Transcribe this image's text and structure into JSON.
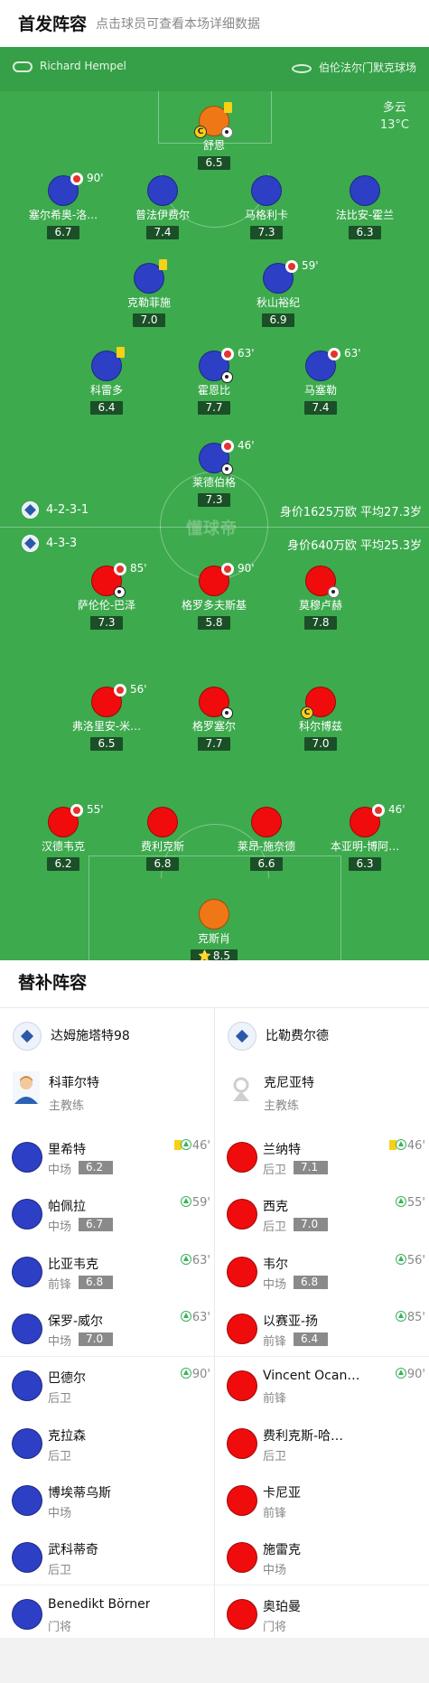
{
  "header": {
    "title": "首发阵容",
    "subtitle": "点击球员可查看本场详细数据"
  },
  "pitch": {
    "referee": "Richard Hempel",
    "stadium": "伯伦法尔门默克球场",
    "weather_desc": "多云",
    "weather_temp": "13°C",
    "watermark": "懂球帝",
    "home_formation": "4-2-3-1",
    "home_info": "身价1625万欧  平均27.3岁",
    "away_formation": "4-3-3",
    "away_info": "身价640万欧  平均25.3岁"
  },
  "home_players": [
    {
      "name": "舒恩",
      "rating": "6.5",
      "color": "orange",
      "captain": "C",
      "yellow": true,
      "ball": "grey"
    },
    {
      "name": "塞尔希奥-洛…",
      "rating": "6.7",
      "color": "blue",
      "sub_min": "90'"
    },
    {
      "name": "普法伊费尔",
      "rating": "7.4",
      "color": "blue"
    },
    {
      "name": "马格利卡",
      "rating": "7.3",
      "color": "blue"
    },
    {
      "name": "法比安-霍兰",
      "rating": "6.3",
      "color": "blue"
    },
    {
      "name": "克勒菲施",
      "rating": "7.0",
      "color": "blue",
      "yellow": true
    },
    {
      "name": "秋山裕纪",
      "rating": "6.9",
      "color": "blue",
      "sub_min": "59'"
    },
    {
      "name": "科雷多",
      "rating": "6.4",
      "color": "blue",
      "yellow": true
    },
    {
      "name": "霍恩比",
      "rating": "7.7",
      "color": "blue",
      "sub_min": "63'",
      "ball": "black"
    },
    {
      "name": "马塞勒",
      "rating": "7.4",
      "color": "blue",
      "sub_min": "63'"
    },
    {
      "name": "莱德伯格",
      "rating": "7.3",
      "color": "blue",
      "sub_min": "46'",
      "ball": "black"
    }
  ],
  "away_players": [
    {
      "name": "萨伦伦-巴泽",
      "rating": "7.3",
      "color": "red",
      "sub_min": "85'",
      "ball": "black"
    },
    {
      "name": "格罗多夫斯基",
      "rating": "5.8",
      "color": "red",
      "sub_min": "90'"
    },
    {
      "name": "莫穆卢赫",
      "rating": "7.8",
      "color": "red",
      "ball": "grey"
    },
    {
      "name": "弗洛里安-米…",
      "rating": "6.5",
      "color": "red",
      "sub_min": "56'"
    },
    {
      "name": "格罗塞尔",
      "rating": "7.7",
      "color": "red",
      "ball": "black"
    },
    {
      "name": "科尔博兹",
      "rating": "7.0",
      "color": "red",
      "captain": "C"
    },
    {
      "name": "汉德韦克",
      "rating": "6.2",
      "color": "red",
      "sub_min": "55'"
    },
    {
      "name": "费利克斯",
      "rating": "6.8",
      "color": "red"
    },
    {
      "name": "莱昂-施奈德",
      "rating": "6.6",
      "color": "red"
    },
    {
      "name": "本亚明-博阿…",
      "rating": "6.3",
      "color": "red",
      "sub_min": "46'"
    },
    {
      "name": "克斯肖",
      "rating": "8.5",
      "color": "orange",
      "star": "⭐"
    }
  ],
  "subs": {
    "title": "替补阵容",
    "home_team": "达姆施塔特98",
    "away_team": "比勒费尔德",
    "home_coach": {
      "name": "科菲尔特",
      "role": "主教练"
    },
    "away_coach": {
      "name": "克尼亚特",
      "role": "主教练"
    },
    "home": [
      {
        "name": "里希特",
        "pos": "中场",
        "rating": "6.2",
        "min": "46'",
        "yellow": true
      },
      {
        "name": "帕佩拉",
        "pos": "中场",
        "rating": "6.7",
        "min": "59'"
      },
      {
        "name": "比亚韦克",
        "pos": "前锋",
        "rating": "6.8",
        "min": "63'"
      },
      {
        "name": "保罗-威尔",
        "pos": "中场",
        "rating": "7.0",
        "min": "63'"
      },
      {
        "name": "巴德尔",
        "pos": "后卫",
        "min": "90'"
      },
      {
        "name": "克拉森",
        "pos": "后卫"
      },
      {
        "name": "博埃蒂乌斯",
        "pos": "中场"
      },
      {
        "name": "武科蒂奇",
        "pos": "后卫"
      },
      {
        "name": "Benedikt Börner",
        "pos": "门将"
      }
    ],
    "away": [
      {
        "name": "兰纳特",
        "pos": "后卫",
        "rating": "7.1",
        "min": "46'",
        "yellow": true
      },
      {
        "name": "西克",
        "pos": "后卫",
        "rating": "7.0",
        "min": "55'"
      },
      {
        "name": "韦尔",
        "pos": "中场",
        "rating": "6.8",
        "min": "56'"
      },
      {
        "name": "以赛亚-扬",
        "pos": "前锋",
        "rating": "6.4",
        "min": "85'"
      },
      {
        "name": "Vincent Ocan…",
        "pos": "前锋",
        "min": "90'"
      },
      {
        "name": "费利克斯-哈…",
        "pos": "后卫"
      },
      {
        "name": "卡尼亚",
        "pos": "前锋"
      },
      {
        "name": "施雷克",
        "pos": "中场"
      },
      {
        "name": "奥珀曼",
        "pos": "门将"
      }
    ]
  }
}
